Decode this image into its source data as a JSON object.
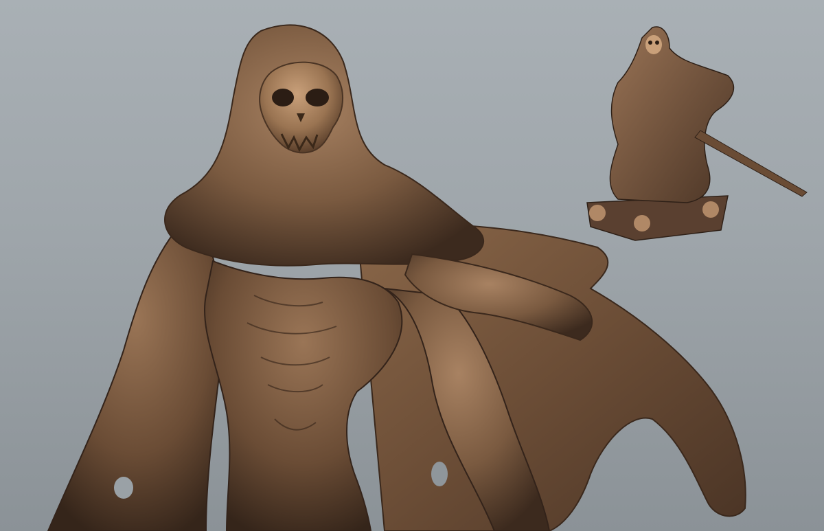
{
  "scene": {
    "subject": "hooded-reaper-sculpt",
    "views": [
      "closeup",
      "full-figure-thumbnail"
    ],
    "colors": {
      "background_top": "#a9b0b5",
      "background_bottom": "#8b9297",
      "clay_light": "#b08866",
      "clay_mid": "#7a5a40",
      "clay_dark": "#3c2a1e"
    }
  }
}
